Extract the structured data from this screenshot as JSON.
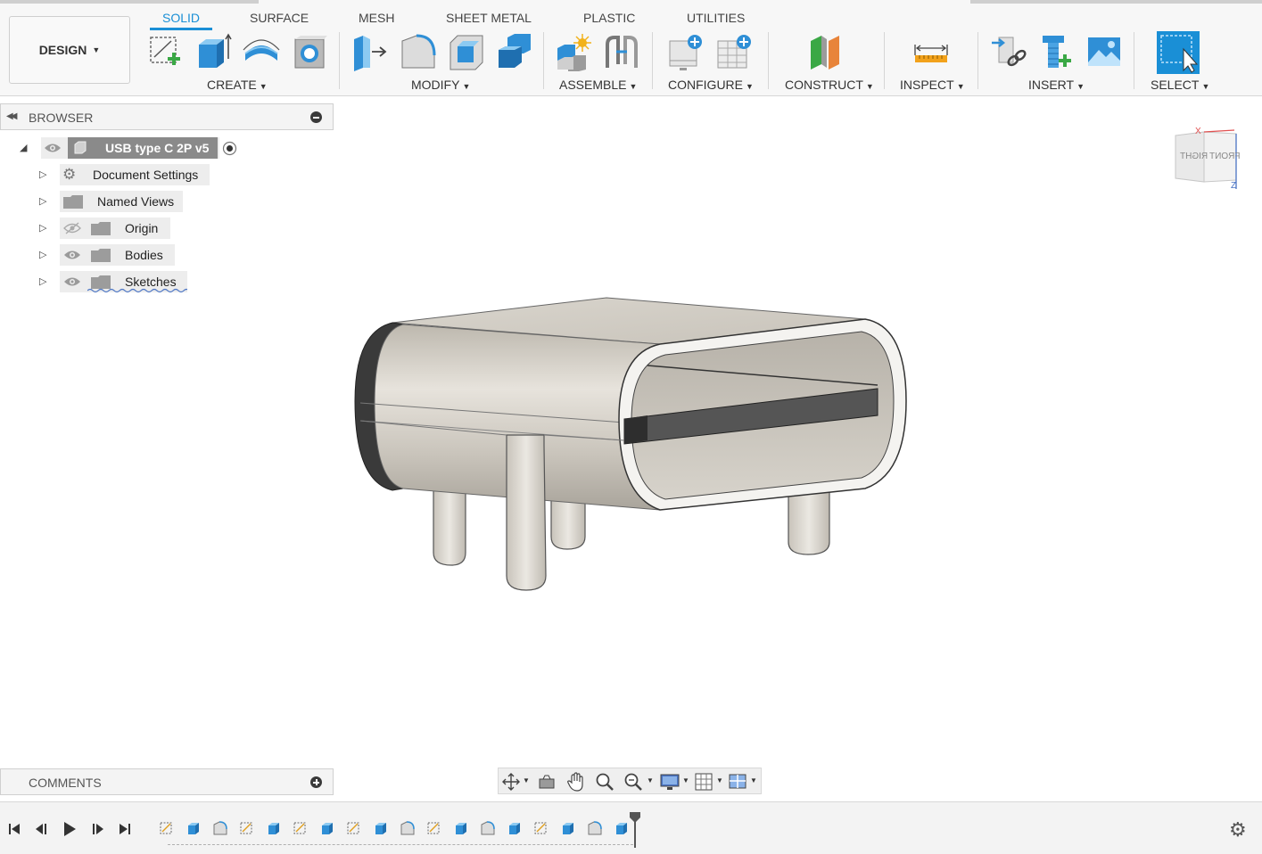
{
  "toolbar": {
    "design_label": "DESIGN",
    "tabs": [
      {
        "label": "SOLID",
        "active": true
      },
      {
        "label": "SURFACE",
        "active": false
      },
      {
        "label": "MESH",
        "active": false
      },
      {
        "label": "SHEET METAL",
        "active": false
      },
      {
        "label": "PLASTIC",
        "active": false
      },
      {
        "label": "UTILITIES",
        "active": false
      }
    ],
    "groups": {
      "create": "CREATE",
      "modify": "MODIFY",
      "assemble": "ASSEMBLE",
      "configure": "CONFIGURE",
      "construct": "CONSTRUCT",
      "inspect": "INSPECT",
      "insert": "INSERT",
      "select": "SELECT"
    },
    "accent_color": "#1a8fd6"
  },
  "browser": {
    "title": "BROWSER",
    "root": {
      "label": "USB type C 2P v5"
    },
    "items": [
      {
        "label": "Document Settings",
        "icon": "gear-icon"
      },
      {
        "label": "Named Views",
        "icon": "folder-icon"
      },
      {
        "label": "Origin",
        "icon": "folder-icon",
        "visibility": "hidden"
      },
      {
        "label": "Bodies",
        "icon": "folder-icon",
        "visibility": "visible"
      },
      {
        "label": "Sketches",
        "icon": "folder-icon",
        "visibility": "visible"
      }
    ]
  },
  "viewcube": {
    "right_label": "RIGHT",
    "front_label": "FRONT",
    "x_axis": "X",
    "z_axis": "Z"
  },
  "comments": {
    "title": "COMMENTS"
  },
  "timeline": {
    "features": [
      "sketch",
      "extrude",
      "fillet",
      "sketch",
      "extrude",
      "sketch",
      "extrude",
      "sketch",
      "extrude",
      "fillet",
      "sketch",
      "extrude",
      "fillet",
      "extrude",
      "sketch",
      "extrude",
      "fillet",
      "extrude"
    ]
  }
}
